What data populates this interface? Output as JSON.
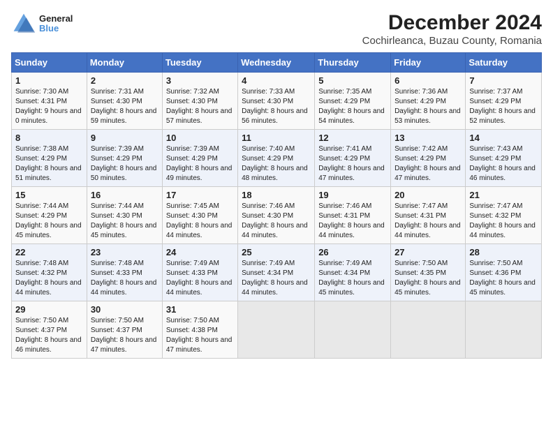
{
  "header": {
    "logo_line1": "General",
    "logo_line2": "Blue",
    "title": "December 2024",
    "subtitle": "Cochirleanca, Buzau County, Romania"
  },
  "weekdays": [
    "Sunday",
    "Monday",
    "Tuesday",
    "Wednesday",
    "Thursday",
    "Friday",
    "Saturday"
  ],
  "weeks": [
    [
      {
        "day": "1",
        "sunrise": "Sunrise: 7:30 AM",
        "sunset": "Sunset: 4:31 PM",
        "daylight": "Daylight: 9 hours and 0 minutes."
      },
      {
        "day": "2",
        "sunrise": "Sunrise: 7:31 AM",
        "sunset": "Sunset: 4:30 PM",
        "daylight": "Daylight: 8 hours and 59 minutes."
      },
      {
        "day": "3",
        "sunrise": "Sunrise: 7:32 AM",
        "sunset": "Sunset: 4:30 PM",
        "daylight": "Daylight: 8 hours and 57 minutes."
      },
      {
        "day": "4",
        "sunrise": "Sunrise: 7:33 AM",
        "sunset": "Sunset: 4:30 PM",
        "daylight": "Daylight: 8 hours and 56 minutes."
      },
      {
        "day": "5",
        "sunrise": "Sunrise: 7:35 AM",
        "sunset": "Sunset: 4:29 PM",
        "daylight": "Daylight: 8 hours and 54 minutes."
      },
      {
        "day": "6",
        "sunrise": "Sunrise: 7:36 AM",
        "sunset": "Sunset: 4:29 PM",
        "daylight": "Daylight: 8 hours and 53 minutes."
      },
      {
        "day": "7",
        "sunrise": "Sunrise: 7:37 AM",
        "sunset": "Sunset: 4:29 PM",
        "daylight": "Daylight: 8 hours and 52 minutes."
      }
    ],
    [
      {
        "day": "8",
        "sunrise": "Sunrise: 7:38 AM",
        "sunset": "Sunset: 4:29 PM",
        "daylight": "Daylight: 8 hours and 51 minutes."
      },
      {
        "day": "9",
        "sunrise": "Sunrise: 7:39 AM",
        "sunset": "Sunset: 4:29 PM",
        "daylight": "Daylight: 8 hours and 50 minutes."
      },
      {
        "day": "10",
        "sunrise": "Sunrise: 7:39 AM",
        "sunset": "Sunset: 4:29 PM",
        "daylight": "Daylight: 8 hours and 49 minutes."
      },
      {
        "day": "11",
        "sunrise": "Sunrise: 7:40 AM",
        "sunset": "Sunset: 4:29 PM",
        "daylight": "Daylight: 8 hours and 48 minutes."
      },
      {
        "day": "12",
        "sunrise": "Sunrise: 7:41 AM",
        "sunset": "Sunset: 4:29 PM",
        "daylight": "Daylight: 8 hours and 47 minutes."
      },
      {
        "day": "13",
        "sunrise": "Sunrise: 7:42 AM",
        "sunset": "Sunset: 4:29 PM",
        "daylight": "Daylight: 8 hours and 47 minutes."
      },
      {
        "day": "14",
        "sunrise": "Sunrise: 7:43 AM",
        "sunset": "Sunset: 4:29 PM",
        "daylight": "Daylight: 8 hours and 46 minutes."
      }
    ],
    [
      {
        "day": "15",
        "sunrise": "Sunrise: 7:44 AM",
        "sunset": "Sunset: 4:29 PM",
        "daylight": "Daylight: 8 hours and 45 minutes."
      },
      {
        "day": "16",
        "sunrise": "Sunrise: 7:44 AM",
        "sunset": "Sunset: 4:30 PM",
        "daylight": "Daylight: 8 hours and 45 minutes."
      },
      {
        "day": "17",
        "sunrise": "Sunrise: 7:45 AM",
        "sunset": "Sunset: 4:30 PM",
        "daylight": "Daylight: 8 hours and 44 minutes."
      },
      {
        "day": "18",
        "sunrise": "Sunrise: 7:46 AM",
        "sunset": "Sunset: 4:30 PM",
        "daylight": "Daylight: 8 hours and 44 minutes."
      },
      {
        "day": "19",
        "sunrise": "Sunrise: 7:46 AM",
        "sunset": "Sunset: 4:31 PM",
        "daylight": "Daylight: 8 hours and 44 minutes."
      },
      {
        "day": "20",
        "sunrise": "Sunrise: 7:47 AM",
        "sunset": "Sunset: 4:31 PM",
        "daylight": "Daylight: 8 hours and 44 minutes."
      },
      {
        "day": "21",
        "sunrise": "Sunrise: 7:47 AM",
        "sunset": "Sunset: 4:32 PM",
        "daylight": "Daylight: 8 hours and 44 minutes."
      }
    ],
    [
      {
        "day": "22",
        "sunrise": "Sunrise: 7:48 AM",
        "sunset": "Sunset: 4:32 PM",
        "daylight": "Daylight: 8 hours and 44 minutes."
      },
      {
        "day": "23",
        "sunrise": "Sunrise: 7:48 AM",
        "sunset": "Sunset: 4:33 PM",
        "daylight": "Daylight: 8 hours and 44 minutes."
      },
      {
        "day": "24",
        "sunrise": "Sunrise: 7:49 AM",
        "sunset": "Sunset: 4:33 PM",
        "daylight": "Daylight: 8 hours and 44 minutes."
      },
      {
        "day": "25",
        "sunrise": "Sunrise: 7:49 AM",
        "sunset": "Sunset: 4:34 PM",
        "daylight": "Daylight: 8 hours and 44 minutes."
      },
      {
        "day": "26",
        "sunrise": "Sunrise: 7:49 AM",
        "sunset": "Sunset: 4:34 PM",
        "daylight": "Daylight: 8 hours and 45 minutes."
      },
      {
        "day": "27",
        "sunrise": "Sunrise: 7:50 AM",
        "sunset": "Sunset: 4:35 PM",
        "daylight": "Daylight: 8 hours and 45 minutes."
      },
      {
        "day": "28",
        "sunrise": "Sunrise: 7:50 AM",
        "sunset": "Sunset: 4:36 PM",
        "daylight": "Daylight: 8 hours and 45 minutes."
      }
    ],
    [
      {
        "day": "29",
        "sunrise": "Sunrise: 7:50 AM",
        "sunset": "Sunset: 4:37 PM",
        "daylight": "Daylight: 8 hours and 46 minutes."
      },
      {
        "day": "30",
        "sunrise": "Sunrise: 7:50 AM",
        "sunset": "Sunset: 4:37 PM",
        "daylight": "Daylight: 8 hours and 47 minutes."
      },
      {
        "day": "31",
        "sunrise": "Sunrise: 7:50 AM",
        "sunset": "Sunset: 4:38 PM",
        "daylight": "Daylight: 8 hours and 47 minutes."
      },
      null,
      null,
      null,
      null
    ]
  ]
}
